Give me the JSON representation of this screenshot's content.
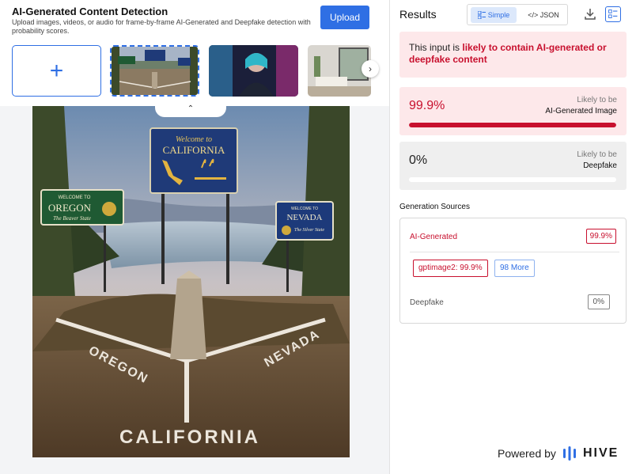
{
  "app": {
    "title": "AI-Generated Content Detection",
    "subtitle": "Upload images, videos, or audio for frame-by-frame AI-Generated and Deepfake detection with probability scores.",
    "upload_label": "Upload"
  },
  "thumbnails": {
    "add_icon": "plus-icon",
    "next_icon": "chevron-right-icon",
    "collapse_icon": "chevron-up-icon"
  },
  "main_image": {
    "signs": {
      "california_top": "Welcome to",
      "california_name": "CALIFORNIA",
      "oregon_top": "WELCOME TO",
      "oregon_name": "OREGON",
      "oregon_motto": "The Beaver State",
      "nevada_top": "WELCOME TO",
      "nevada_name": "NEVADA",
      "nevada_motto": "The Silver State"
    },
    "ground_text": {
      "oregon": "OREGON",
      "nevada": "NEVADA",
      "california": "CALIFORNIA"
    }
  },
  "results": {
    "title": "Results",
    "toggle": {
      "simple": "Simple",
      "json": "</> JSON"
    },
    "verdict_prefix": "This input is ",
    "verdict_highlight": "likely to contain AI-generated or deepfake content",
    "ai": {
      "value": "99.9%",
      "fraction": 0.999,
      "label_small": "Likely to be",
      "label_big": "AI-Generated Image"
    },
    "deepfake": {
      "value": "0%",
      "fraction": 0.0,
      "label_small": "Likely to be",
      "label_big": "Deepfake"
    },
    "sources": {
      "title": "Generation Sources",
      "ai_label": "AI-Generated",
      "ai_value": "99.9%",
      "chip_model": "gptimage2: 99.9%",
      "chip_more": "98 More",
      "deepfake_label": "Deepfake",
      "deepfake_value": "0%"
    }
  },
  "footer": {
    "powered_by": "Powered by",
    "brand": "HIVE"
  },
  "colors": {
    "accent": "#2f6fe4",
    "danger": "#c8102e",
    "danger_bg": "#fde8ea"
  }
}
